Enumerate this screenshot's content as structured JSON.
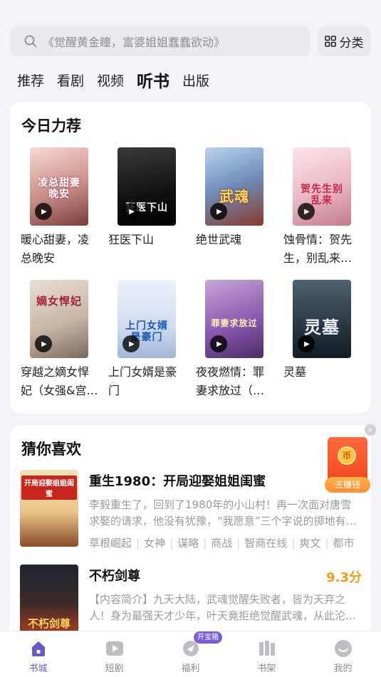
{
  "search": {
    "placeholder": "《觉醒黄金瞳，富婆姐姐蠢蠢欲动》"
  },
  "category_button": {
    "label": "分类"
  },
  "tabs": [
    {
      "label": "推荐"
    },
    {
      "label": "看剧"
    },
    {
      "label": "视频"
    },
    {
      "label": "听书",
      "active": true
    },
    {
      "label": "出版"
    }
  ],
  "recommend": {
    "title": "今日力荐",
    "books": [
      {
        "name": "暖心甜妻，凌总晚安",
        "cover_text": "凌总甜妻晚安"
      },
      {
        "name": "狂医下山",
        "cover_text": "狂医下山"
      },
      {
        "name": "绝世武魂",
        "cover_text": "武魂"
      },
      {
        "name": "蚀骨情：贺先生，别乱来…",
        "cover_text": "贺先生别乱来"
      },
      {
        "name": "穿越之嫡女悍妃（女强&宫…",
        "cover_text": "嫡女悍妃"
      },
      {
        "name": "上门女婿是豪门",
        "cover_text": "上门女婿是豪门"
      },
      {
        "name": "夜夜燃情：罪妻求放过（…",
        "cover_text": "罪妻求放过"
      },
      {
        "name": "灵墓",
        "cover_text": "灵墓"
      }
    ]
  },
  "guess": {
    "title": "猜你喜欢",
    "items": [
      {
        "name": "重生1980：开局迎娶姐姐闺蜜",
        "score": "",
        "cover_text": "开局迎娶姐姐闺蜜",
        "desc": "李毅重生了，回到了1980年的小山村！再一次面对唐雪求娶的请求，他没有犹豫，“我愿意”三个字说的掷地有声！",
        "tags": [
          "草根崛起",
          "女神",
          "谋略",
          "商战",
          "智商在线",
          "爽文",
          "都市"
        ]
      },
      {
        "name": "不朽剑尊",
        "score": "9.3分",
        "cover_text": "不朽剑尊",
        "desc": "【内容简介】九天大陆，武魂觉醒失败者，皆为天弃之人！身为最强天才少年，叶天竟拒绝觉醒武魂，从此沦为笑柄……",
        "tags": []
      }
    ]
  },
  "float_packet": {
    "label": "去赚钱",
    "coin": "币"
  },
  "bottom_nav": [
    {
      "label": "书城",
      "active": true,
      "icon": "home-icon"
    },
    {
      "label": "短剧",
      "icon": "play-icon"
    },
    {
      "label": "福利",
      "icon": "gift-icon",
      "badge": "开宝箱"
    },
    {
      "label": "书架",
      "icon": "bookshelf-icon"
    },
    {
      "label": "我的",
      "icon": "profile-icon"
    }
  ],
  "colors": {
    "accent": "#6b57c7",
    "score": "#f39b1a",
    "background": "#f3f3f7"
  }
}
